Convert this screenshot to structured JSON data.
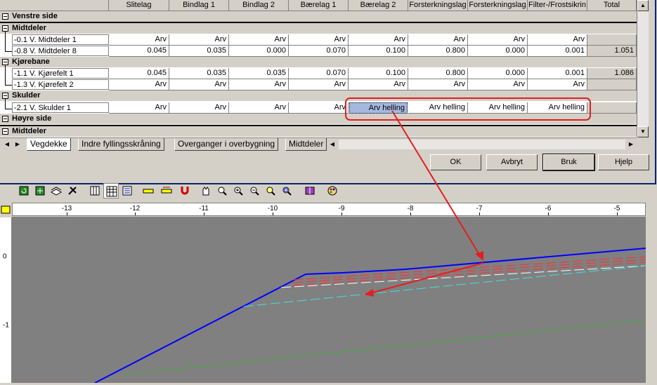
{
  "grid": {
    "columns": [
      "Slitelag",
      "Bindlag 1",
      "Bindlag 2",
      "Bærelag 1",
      "Bærelag 2",
      "Forsterkningslag",
      "Forsterkningslag",
      "Filter-/Frostsikrin",
      "Total"
    ],
    "groups": [
      {
        "label": "Venstre side",
        "rows": []
      },
      {
        "label": "Midtdeler",
        "rows": [
          {
            "label": "-0.1 V. Midtdeler 1",
            "values": [
              "Arv",
              "Arv",
              "Arv",
              "Arv",
              "Arv",
              "Arv",
              "Arv",
              "Arv",
              ""
            ]
          },
          {
            "label": "-0.8 V. Midtdeler 8",
            "values": [
              "0.045",
              "0.035",
              "0.000",
              "0.070",
              "0.100",
              "0.800",
              "0.000",
              "0.001",
              "1.051"
            ]
          }
        ]
      },
      {
        "label": "Kjørebane",
        "rows": [
          {
            "label": "-1.1 V. Kjørefelt 1",
            "values": [
              "0.045",
              "0.035",
              "0.035",
              "0.070",
              "0.100",
              "0.800",
              "0.000",
              "0.001",
              "1.086"
            ]
          },
          {
            "label": "-1.3 V. Kjørefelt 2",
            "values": [
              "Arv",
              "Arv",
              "Arv",
              "Arv",
              "Arv",
              "Arv",
              "Arv",
              "Arv",
              ""
            ]
          }
        ]
      },
      {
        "label": "Skulder",
        "rows": [
          {
            "label": "-2.1 V. Skulder 1",
            "values": [
              "Arv",
              "Arv",
              "Arv",
              "Arv",
              "Arv helling",
              "Arv helling",
              "Arv helling",
              "Arv helling",
              ""
            ]
          }
        ]
      },
      {
        "label": "Høyre side",
        "rows": []
      },
      {
        "label": "Midtdeler",
        "rows": []
      }
    ]
  },
  "tabs": [
    "Vegdekke",
    "Indre fyllingsskråning",
    "Overganger i overbygning",
    "Midtdeler"
  ],
  "buttons": {
    "ok": "OK",
    "cancel": "Avbryt",
    "apply": "Bruk",
    "help": "Hjelp"
  },
  "ruler": {
    "x_labels": [
      "-13",
      "-12",
      "-11",
      "-10",
      "-9",
      "-8",
      "-7",
      "-6",
      "-5"
    ],
    "y_labels": [
      "0",
      "-1"
    ]
  },
  "colors": {
    "highlight": "#e03030",
    "surface": "#0000ff",
    "canvas": "#808080"
  }
}
